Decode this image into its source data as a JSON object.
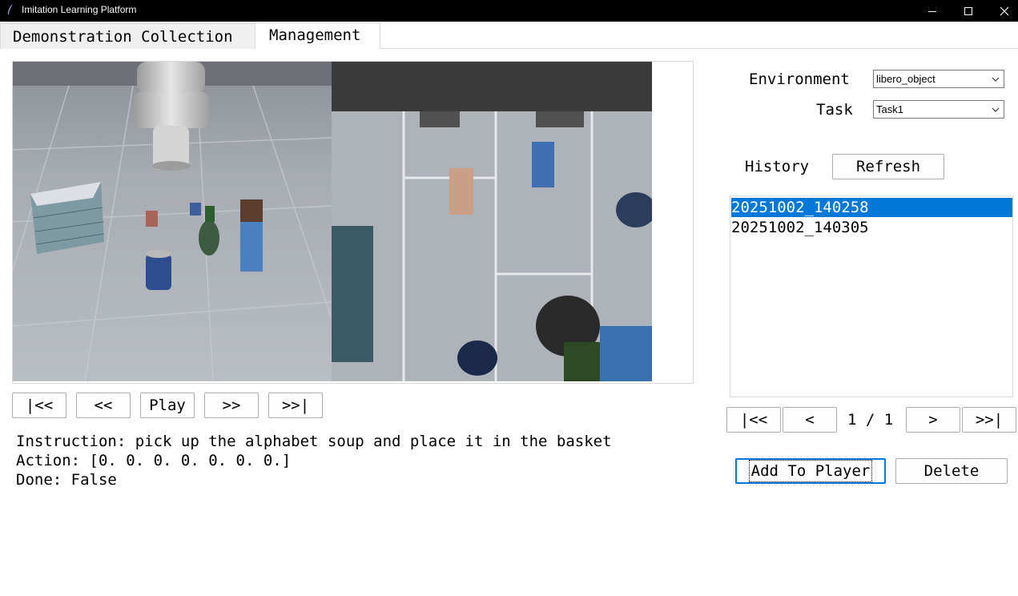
{
  "window": {
    "title": "Imitation Learning Platform",
    "controls": [
      "minimize-icon",
      "maximize-icon",
      "close-icon"
    ]
  },
  "tabs": [
    {
      "label": "Demonstration Collection",
      "active": false
    },
    {
      "label": "Management",
      "active": true
    }
  ],
  "player": {
    "buttons": {
      "first": "|<<",
      "prev": "<<",
      "play": "Play",
      "next": ">>",
      "last": ">>|"
    },
    "instruction_label": "Instruction:",
    "instruction_text": " pick up the alphabet soup and place it in the basket",
    "action_label": "Action:",
    "action_value": "[0. 0. 0. 0. 0. 0. 0.]",
    "done_label": "Done:",
    "done_value": "False"
  },
  "settings": {
    "environment_label": "Environment",
    "environment_value": "libero_object",
    "task_label": "Task",
    "task_value": "Task1"
  },
  "history": {
    "label": "History",
    "refresh_label": "Refresh",
    "items": [
      "20251002_140258",
      "20251002_140305"
    ],
    "selected_index": 0,
    "pager": {
      "first": "|<<",
      "prev": "<",
      "page_text": "1 / 1",
      "next": ">",
      "last": ">>|"
    },
    "add_label": "Add To Player",
    "delete_label": "Delete"
  },
  "colors": {
    "titlebar": "#000000",
    "selection": "#0078d7",
    "button_border": "#adadad"
  }
}
